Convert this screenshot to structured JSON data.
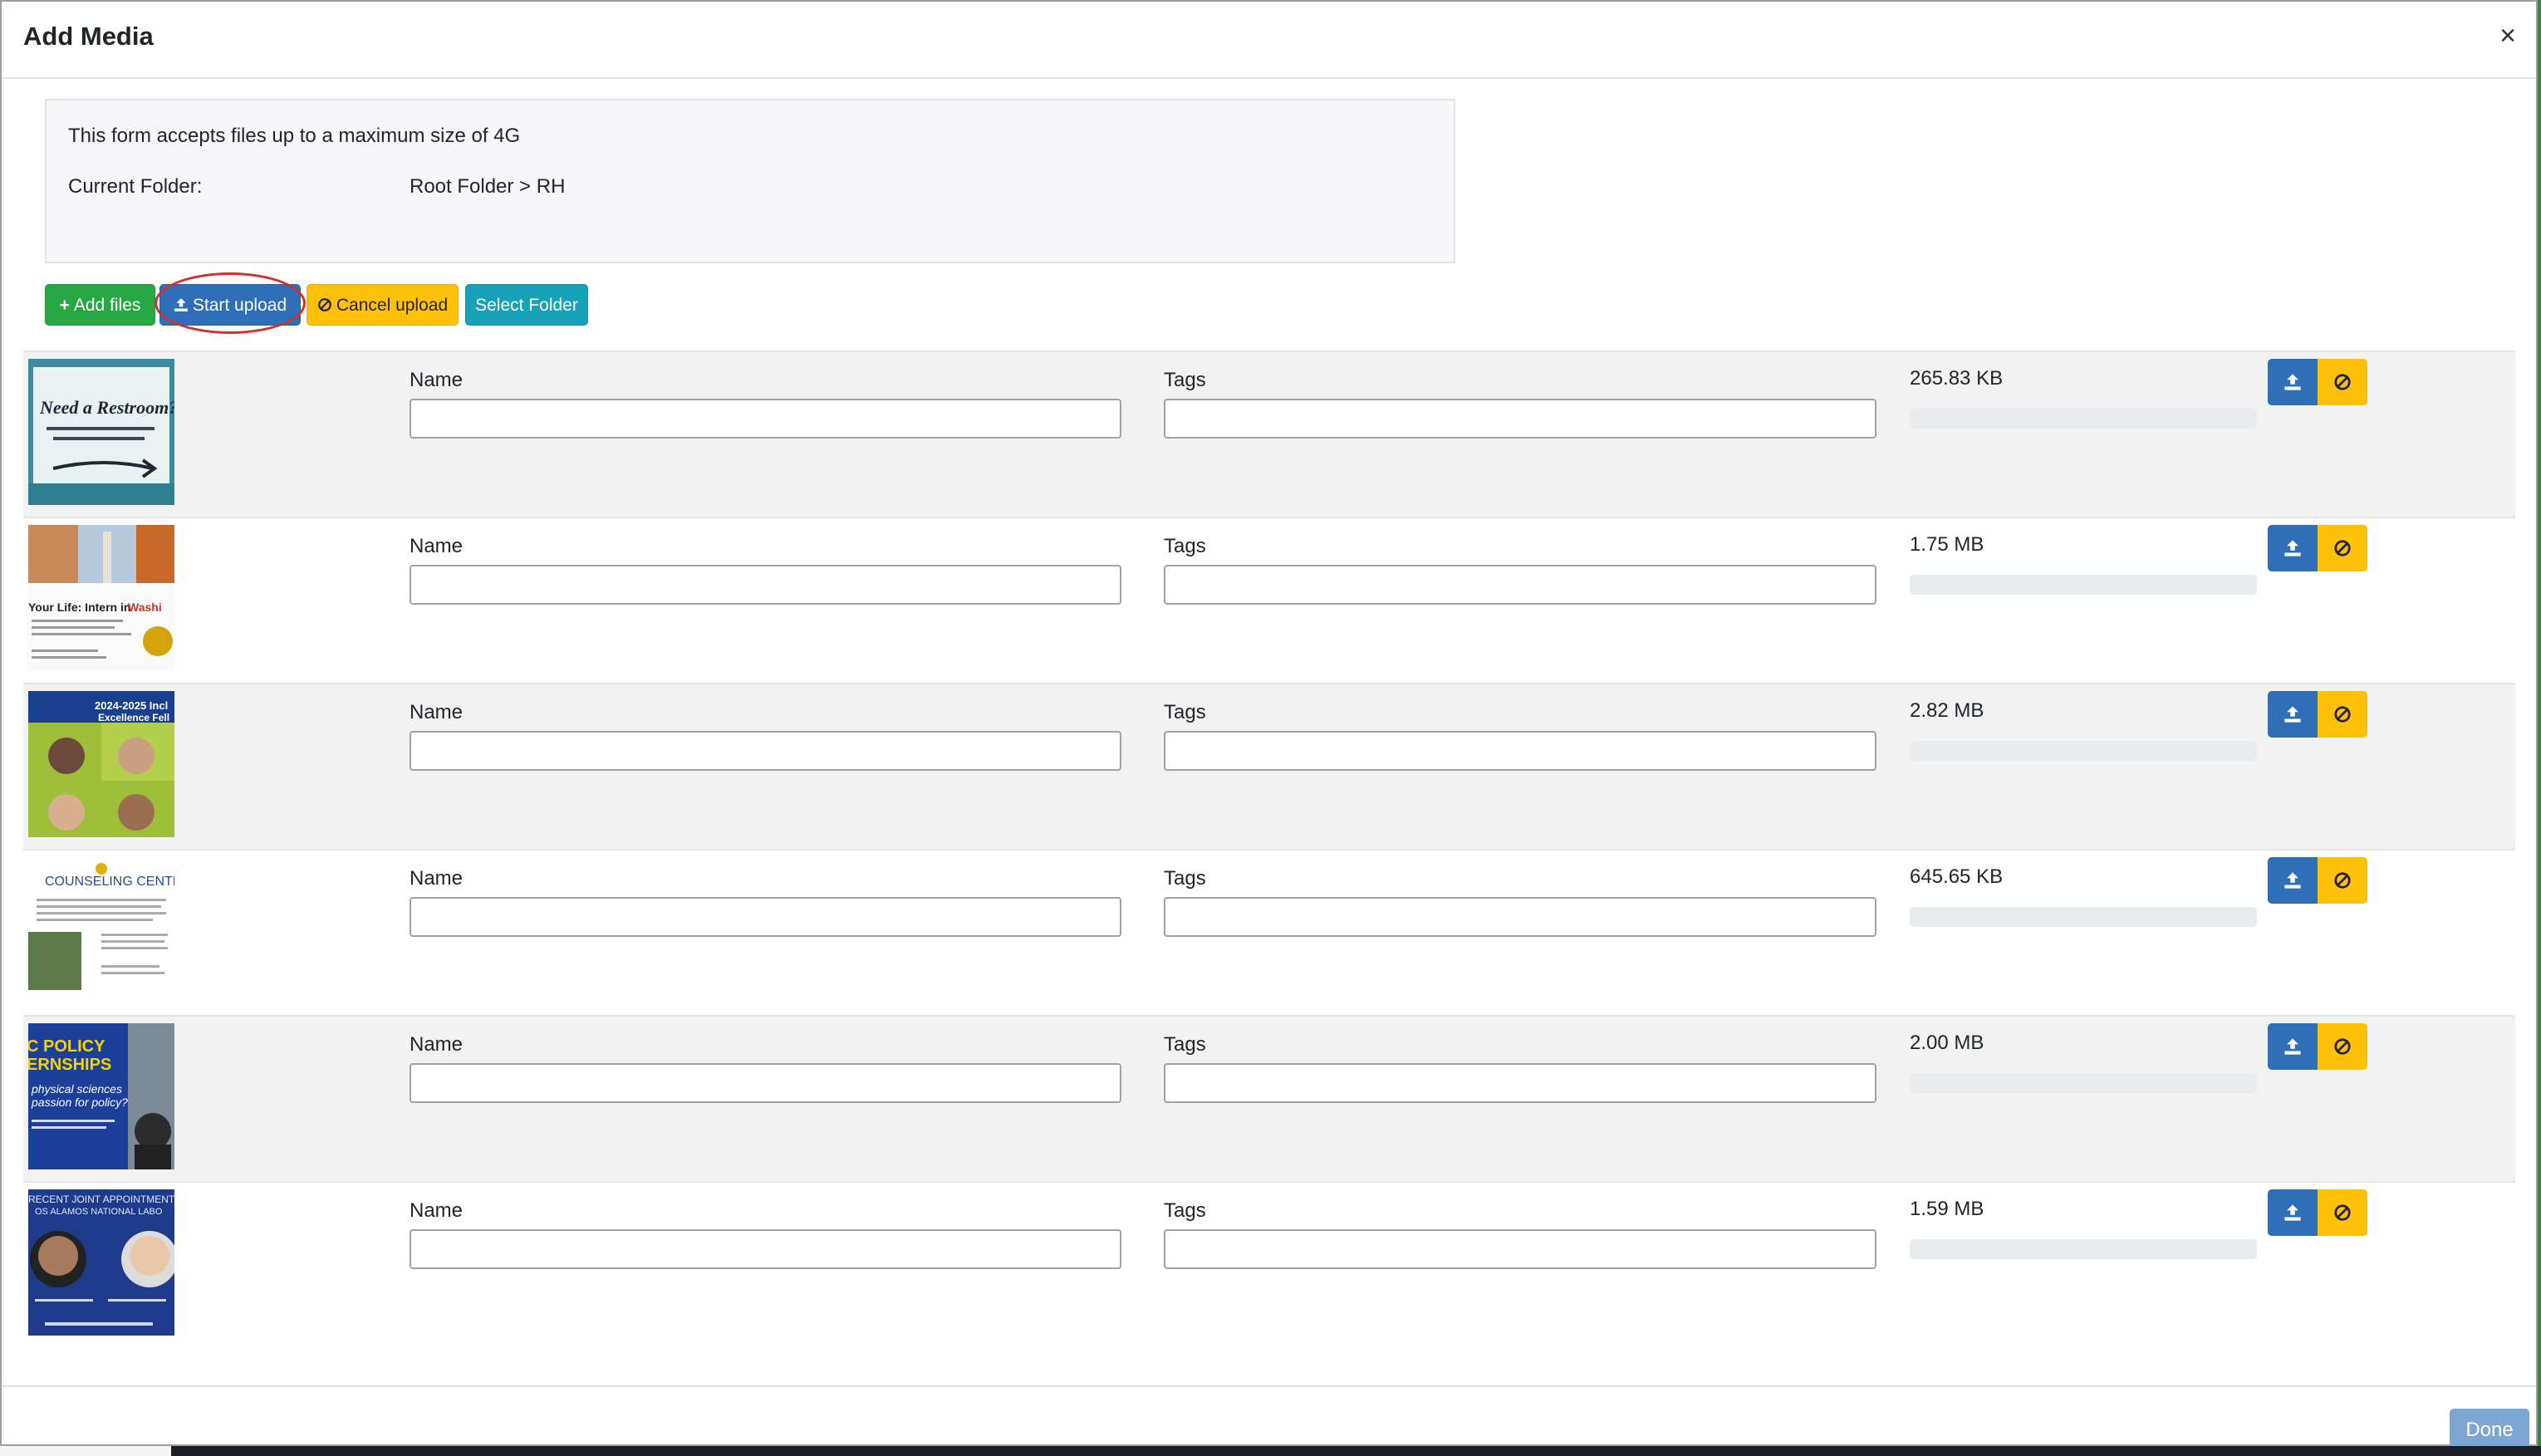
{
  "dialog": {
    "title": "Add Media",
    "close_glyph": "×",
    "info_text": "This form accepts files up to a maximum size of 4G",
    "current_folder_label": "Current Folder:",
    "current_folder_path": "Root Folder > RH"
  },
  "toolbar": {
    "add_files": "Add files",
    "start_upload": "Start upload",
    "cancel_upload": "Cancel upload",
    "select_folder": "Select Folder"
  },
  "colors": {
    "success": "#28a745",
    "primary": "#2f6fb7",
    "warning": "#ffc107",
    "info": "#17a2b8",
    "annotation_circle": "#d32f2f"
  },
  "files": [
    {
      "name_label": "Name",
      "tags_label": "Tags",
      "name_value": "",
      "tags_value": "",
      "size": "265.83 KB",
      "progress": 0,
      "thumbnail": "restroom-sign-thumbnail"
    },
    {
      "name_label": "Name",
      "tags_label": "Tags",
      "name_value": "",
      "tags_value": "",
      "size": "1.75 MB",
      "progress": 0,
      "thumbnail": "intern-washington-thumbnail"
    },
    {
      "name_label": "Name",
      "tags_label": "Tags",
      "name_value": "",
      "tags_value": "",
      "size": "2.82 MB",
      "progress": 0,
      "thumbnail": "excellence-fellows-thumbnail"
    },
    {
      "name_label": "Name",
      "tags_label": "Tags",
      "name_value": "",
      "tags_value": "",
      "size": "645.65 KB",
      "progress": 0,
      "thumbnail": "counseling-center-thumbnail"
    },
    {
      "name_label": "Name",
      "tags_label": "Tags",
      "name_value": "",
      "tags_value": "",
      "size": "2.00 MB",
      "progress": 0,
      "thumbnail": "policy-internships-thumbnail"
    },
    {
      "name_label": "Name",
      "tags_label": "Tags",
      "name_value": "",
      "tags_value": "",
      "size": "1.59 MB",
      "progress": 0,
      "thumbnail": "national-lab-appointments-thumbnail"
    }
  ],
  "footer": {
    "done": "Done"
  }
}
